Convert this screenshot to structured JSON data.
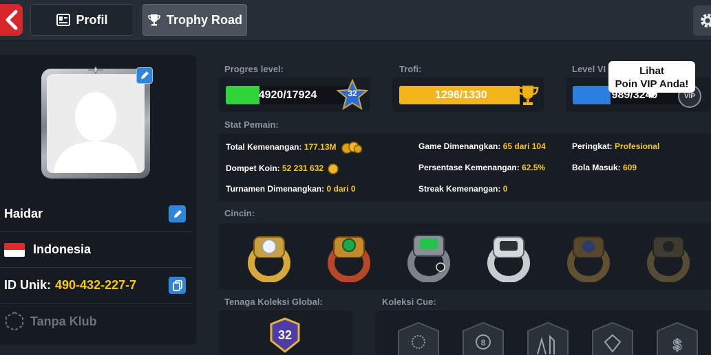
{
  "header": {
    "tabs": [
      {
        "label": "Profil",
        "icon": "profile-card-icon",
        "active": false
      },
      {
        "label": "Trophy Road",
        "icon": "trophy-icon",
        "active": true
      }
    ],
    "back_icon": "chevron-left-icon",
    "settings_icon": "gear-icon"
  },
  "profile": {
    "name": "Haidar",
    "country": "Indonesia",
    "id_label": "ID Unik:",
    "id_value": "490-432-227-7",
    "club": "Tanpa Klub"
  },
  "progress": {
    "level_label": "Progres level:",
    "level_value": "4920/17924",
    "level_fraction": 0.2745,
    "level_badge": "32",
    "trophy_label": "Trofi:",
    "trophy_value": "1296/1330",
    "trophy_fraction": 0.974,
    "vip_label": "Level VI",
    "vip_value": "989/3240",
    "vip_fraction": 0.305,
    "vip_badge": "VIP"
  },
  "tooltip": {
    "line1": "Lihat",
    "line2": "Poin VIP Anda!"
  },
  "stats": {
    "section_label": "Stat Pemain:",
    "total_wins_label": "Total Kemenangan:",
    "total_wins_value": "177.13M",
    "wallet_label": "Dompet Koin:",
    "wallet_value": "52 231 632",
    "tournaments_label": "Turnamen Dimenangkan:",
    "tournaments_value": "0 dari 0",
    "games_won_label": "Game Dimenangkan:",
    "games_won_value": "65 dari 104",
    "win_pct_label": "Persentase Kemenangan:",
    "win_pct_value": "62.5%",
    "streak_label": "Streak Kemenangan:",
    "streak_value": "0",
    "rank_label": "Peringkat:",
    "rank_value": "Profesional",
    "balls_label": "Bola Masuk:",
    "balls_value": "609"
  },
  "rings": {
    "section_label": "Cincin:"
  },
  "collection": {
    "power_label": "Tenaga Koleksi Global:",
    "power_value": "32",
    "cue_label": "Koleksi Cue:"
  },
  "colors": {
    "accent_yellow": "#f6c71a",
    "level_green": "#2fd33a",
    "trophy_gold": "#f4b51a",
    "vip_blue": "#2a7fe0",
    "back_red": "#d8272b"
  }
}
